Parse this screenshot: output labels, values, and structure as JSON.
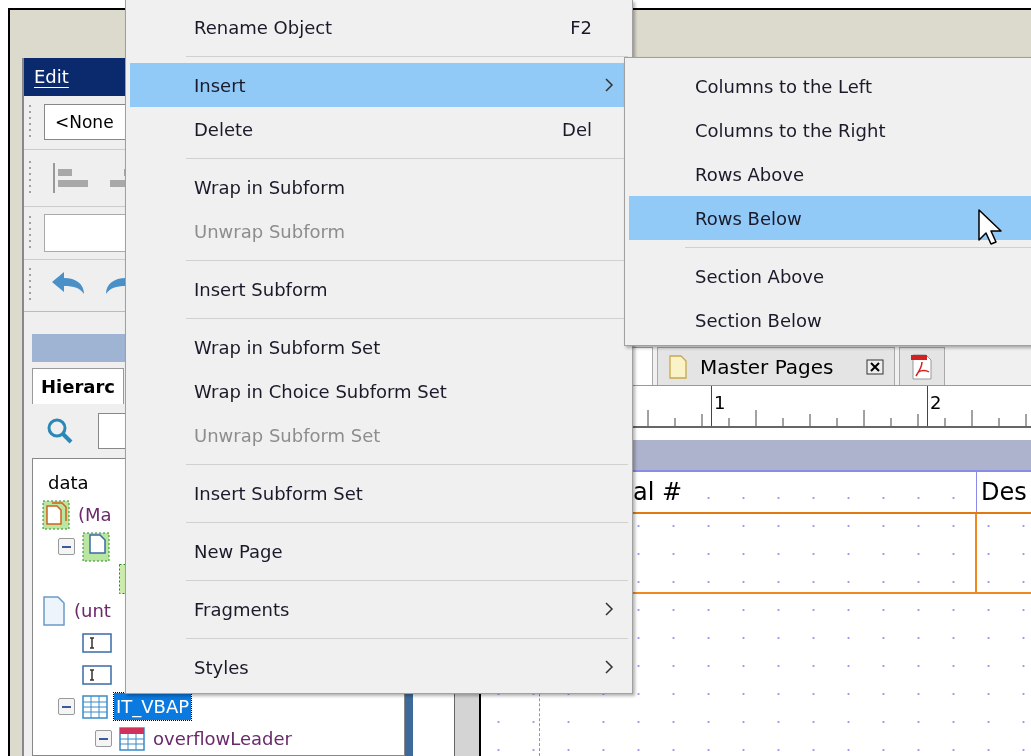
{
  "sidebar": {
    "menu": "Edit",
    "object_combo": {
      "value": "<None"
    },
    "panel_tab": "Hierarc",
    "tree": {
      "root_label": "data",
      "items": [
        {
          "kind": "master-pages",
          "label": "(Ma",
          "selected": false,
          "children": [
            {
              "kind": "master-page",
              "selected": false,
              "expanded": true,
              "children": [
                {
                  "kind": "content-area",
                  "selected": false
                }
              ]
            }
          ]
        },
        {
          "kind": "page",
          "label": "(unt",
          "selected": false,
          "children": [
            {
              "kind": "text-field",
              "selected": false
            },
            {
              "kind": "text-field",
              "selected": false
            },
            {
              "kind": "table",
              "label": "IT_VBAP",
              "selected": true,
              "expanded": true,
              "children": [
                {
                  "kind": "table-row",
                  "label": "overflowLeader",
                  "selected": false,
                  "expanded": true
                }
              ]
            }
          ]
        }
      ]
    }
  },
  "editor": {
    "tabs": [
      {
        "kind": "design",
        "selected": true
      },
      {
        "kind": "master-pages",
        "label": "Master Pages",
        "selected": false,
        "closable": true
      },
      {
        "kind": "pdf-preview",
        "selected": false,
        "closable": false
      }
    ],
    "ruler": [
      "1",
      "2"
    ],
    "table": {
      "header": [
        "al #",
        "Des"
      ]
    }
  },
  "context_menu": {
    "items": [
      {
        "kind": "item",
        "label": "Rename Object",
        "shortcut": "F2",
        "disabled": false,
        "selected": false,
        "has_submenu": false
      },
      {
        "kind": "separator"
      },
      {
        "kind": "item",
        "label": "Insert",
        "disabled": false,
        "selected": true,
        "has_submenu": true
      },
      {
        "kind": "item",
        "label": "Delete",
        "shortcut": "Del",
        "disabled": false,
        "selected": false,
        "has_submenu": false
      },
      {
        "kind": "separator"
      },
      {
        "kind": "item",
        "label": "Wrap in Subform",
        "disabled": false,
        "selected": false,
        "has_submenu": false
      },
      {
        "kind": "item",
        "label": "Unwrap Subform",
        "disabled": true,
        "selected": false,
        "has_submenu": false
      },
      {
        "kind": "separator"
      },
      {
        "kind": "item",
        "label": "Insert Subform",
        "disabled": false,
        "selected": false,
        "has_submenu": false
      },
      {
        "kind": "separator"
      },
      {
        "kind": "item",
        "label": "Wrap in Subform Set",
        "disabled": false,
        "selected": false,
        "has_submenu": false
      },
      {
        "kind": "item",
        "label": "Wrap in Choice Subform Set",
        "disabled": false,
        "selected": false,
        "has_submenu": false
      },
      {
        "kind": "item",
        "label": "Unwrap Subform Set",
        "disabled": true,
        "selected": false,
        "has_submenu": false
      },
      {
        "kind": "separator"
      },
      {
        "kind": "item",
        "label": "Insert Subform Set",
        "disabled": false,
        "selected": false,
        "has_submenu": false
      },
      {
        "kind": "separator"
      },
      {
        "kind": "item",
        "label": "New Page",
        "disabled": false,
        "selected": false,
        "has_submenu": false
      },
      {
        "kind": "separator"
      },
      {
        "kind": "item",
        "label": "Fragments",
        "disabled": false,
        "selected": false,
        "has_submenu": true
      },
      {
        "kind": "separator"
      },
      {
        "kind": "item",
        "label": "Styles",
        "disabled": false,
        "selected": false,
        "has_submenu": true
      }
    ]
  },
  "submenu": {
    "items": [
      {
        "kind": "item",
        "label": "Columns to the Left",
        "selected": false
      },
      {
        "kind": "item",
        "label": "Columns to the Right",
        "selected": false
      },
      {
        "kind": "item",
        "label": "Rows Above",
        "selected": false
      },
      {
        "kind": "item",
        "label": "Rows Below",
        "selected": true
      },
      {
        "kind": "separator"
      },
      {
        "kind": "item",
        "label": "Section Above",
        "selected": false
      },
      {
        "kind": "item",
        "label": "Section Below",
        "selected": false
      }
    ]
  }
}
